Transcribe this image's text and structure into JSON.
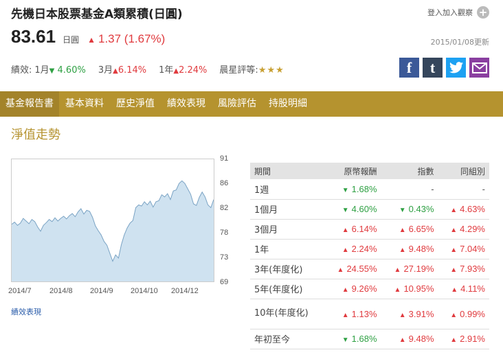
{
  "fund": {
    "name": "先機日本股票基金A類累積(日圓)",
    "nav": "83.61",
    "currency": "日圓",
    "change_arrow": "▲",
    "change": "1.37 (1.67%)",
    "update": "2015/01/08更新"
  },
  "watchlist": {
    "label": "登入加入觀察",
    "icon": "plus-icon"
  },
  "performance": {
    "label": "績效:",
    "items": [
      {
        "period": "1月",
        "arrow": "▼",
        "value": "4.60%",
        "dir": "down"
      },
      {
        "period": "3月",
        "arrow": "▲",
        "value": "6.14%",
        "dir": "up"
      },
      {
        "period": "1年",
        "arrow": "▲",
        "value": "2.24%",
        "dir": "up"
      }
    ],
    "rating_label": "晨星評等:",
    "rating_stars": "★★★",
    "rating": 3
  },
  "social": [
    {
      "name": "facebook-icon",
      "glyph": "f"
    },
    {
      "name": "tumblr-icon",
      "glyph": "t"
    },
    {
      "name": "twitter-icon",
      "glyph": ""
    },
    {
      "name": "email-icon",
      "glyph": ""
    }
  ],
  "tabs": [
    "基金報告書",
    "基本資料",
    "歷史淨值",
    "績效表現",
    "風險評估",
    "持股明細"
  ],
  "section_title": "淨值走勢",
  "perf_link": "績效表現",
  "colors": {
    "accent": "#b5932f",
    "up": "#e03a3e",
    "down": "#2ea043",
    "area": "#cfe2f0",
    "line": "#7aa3c4"
  },
  "chart_data": {
    "type": "area",
    "x_tick_labels": [
      "2014/7",
      "2014/8",
      "2014/9",
      "2014/10",
      "2014/12"
    ],
    "y_tick_labels": [
      "91",
      "86",
      "82",
      "78",
      "73",
      "69"
    ],
    "ylim": [
      69,
      91
    ],
    "values": [
      79.4,
      79.8,
      79.2,
      79.6,
      80.5,
      80.0,
      79.5,
      80.3,
      79.9,
      78.9,
      78.1,
      79.2,
      79.7,
      80.3,
      79.9,
      80.6,
      80.0,
      80.5,
      80.9,
      80.4,
      81.0,
      81.4,
      80.8,
      81.7,
      82.3,
      81.3,
      82.0,
      81.8,
      80.7,
      79.1,
      78.2,
      77.4,
      76.2,
      75.5,
      74.0,
      72.5,
      73.7,
      73.1,
      75.6,
      77.4,
      78.7,
      79.6,
      80.1,
      82.5,
      83.0,
      82.8,
      83.6,
      83.0,
      83.7,
      82.6,
      83.6,
      83.8,
      84.9,
      84.5,
      85.1,
      84.0,
      85.6,
      85.8,
      87.0,
      87.5,
      87.0,
      86.0,
      85.0,
      83.2,
      82.9,
      84.4,
      85.4,
      84.5,
      83.0,
      82.5,
      84.0
    ],
    "grid": false
  },
  "table": {
    "headers": [
      "期間",
      "原幣報酬",
      "指數",
      "同組別"
    ],
    "rows": [
      {
        "period": "1週",
        "cells": [
          {
            "a": "▼",
            "v": "1.68%",
            "d": "down"
          },
          {
            "a": "",
            "v": "-",
            "d": "none"
          },
          {
            "a": "",
            "v": "-",
            "d": "none"
          }
        ]
      },
      {
        "period": "1個月",
        "cells": [
          {
            "a": "▼",
            "v": "4.60%",
            "d": "down"
          },
          {
            "a": "▼",
            "v": "0.43%",
            "d": "down"
          },
          {
            "a": "▲",
            "v": "4.63%",
            "d": "up"
          }
        ]
      },
      {
        "period": "3個月",
        "cells": [
          {
            "a": "▲",
            "v": "6.14%",
            "d": "up"
          },
          {
            "a": "▲",
            "v": "6.65%",
            "d": "up"
          },
          {
            "a": "▲",
            "v": "4.29%",
            "d": "up"
          }
        ]
      },
      {
        "period": "1年",
        "cells": [
          {
            "a": "▲",
            "v": "2.24%",
            "d": "up"
          },
          {
            "a": "▲",
            "v": "9.48%",
            "d": "up"
          },
          {
            "a": "▲",
            "v": "7.04%",
            "d": "up"
          }
        ]
      },
      {
        "period": "3年(年度化)",
        "cells": [
          {
            "a": "▲",
            "v": "24.55%",
            "d": "up"
          },
          {
            "a": "▲",
            "v": "27.19%",
            "d": "up"
          },
          {
            "a": "▲",
            "v": "7.93%",
            "d": "up"
          }
        ]
      },
      {
        "period": "5年(年度化)",
        "cells": [
          {
            "a": "▲",
            "v": "9.26%",
            "d": "up"
          },
          {
            "a": "▲",
            "v": "10.95%",
            "d": "up"
          },
          {
            "a": "▲",
            "v": "4.11%",
            "d": "up"
          }
        ]
      },
      {
        "period": "10年(年度化)",
        "cells": [
          {
            "a": "▲",
            "v": "1.13%",
            "d": "up"
          },
          {
            "a": "▲",
            "v": "3.91%",
            "d": "up"
          },
          {
            "a": "▲",
            "v": "0.99%",
            "d": "up"
          }
        ],
        "tall": true
      },
      {
        "period": "年初至今",
        "cells": [
          {
            "a": "▼",
            "v": "1.68%",
            "d": "down"
          },
          {
            "a": "▲",
            "v": "9.48%",
            "d": "up"
          },
          {
            "a": "▲",
            "v": "2.91%",
            "d": "up"
          }
        ]
      }
    ]
  }
}
